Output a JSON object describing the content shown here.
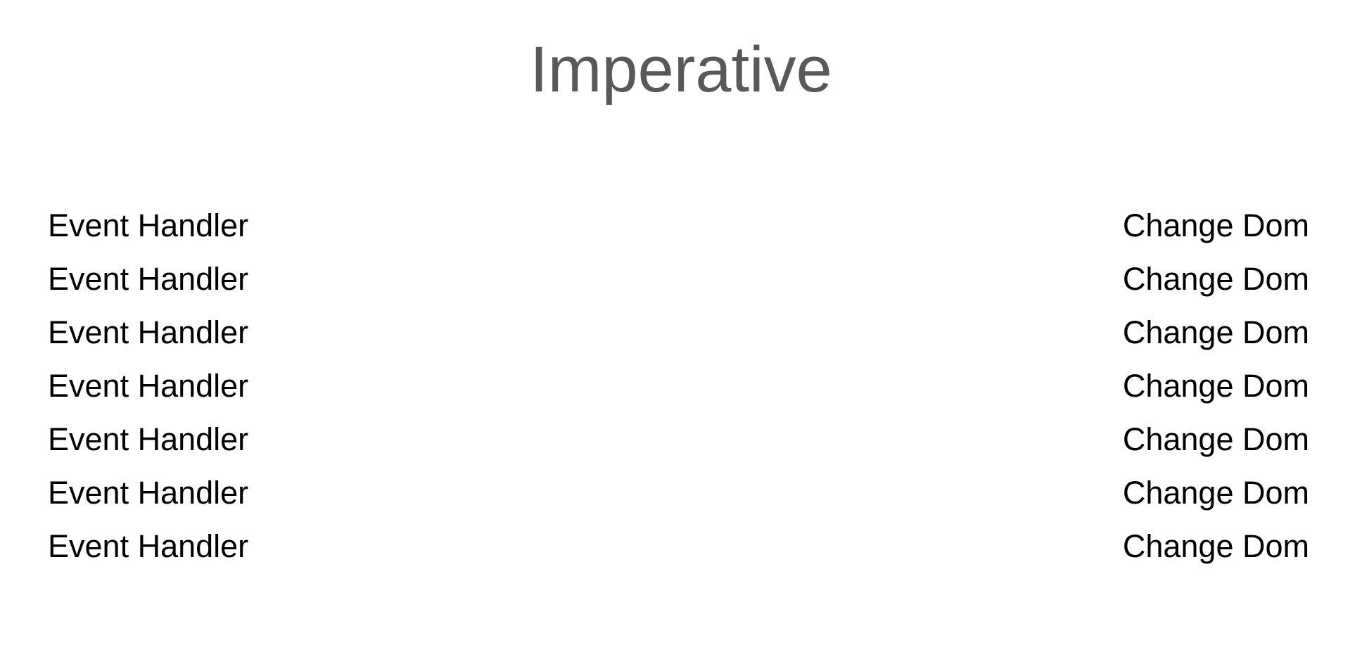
{
  "slide": {
    "title": "Imperative",
    "title_color": "#595959",
    "text_color": "#000000",
    "background": "#ffffff",
    "rows": [
      {
        "left": "Event Handler",
        "right": "Change Dom"
      },
      {
        "left": "Event Handler",
        "right": "Change Dom"
      },
      {
        "left": "Event Handler",
        "right": "Change Dom"
      },
      {
        "left": "Event Handler",
        "right": "Change Dom"
      },
      {
        "left": "Event Handler",
        "right": "Change Dom"
      },
      {
        "left": "Event Handler",
        "right": "Change Dom"
      },
      {
        "left": "Event Handler",
        "right": "Change Dom"
      }
    ]
  }
}
